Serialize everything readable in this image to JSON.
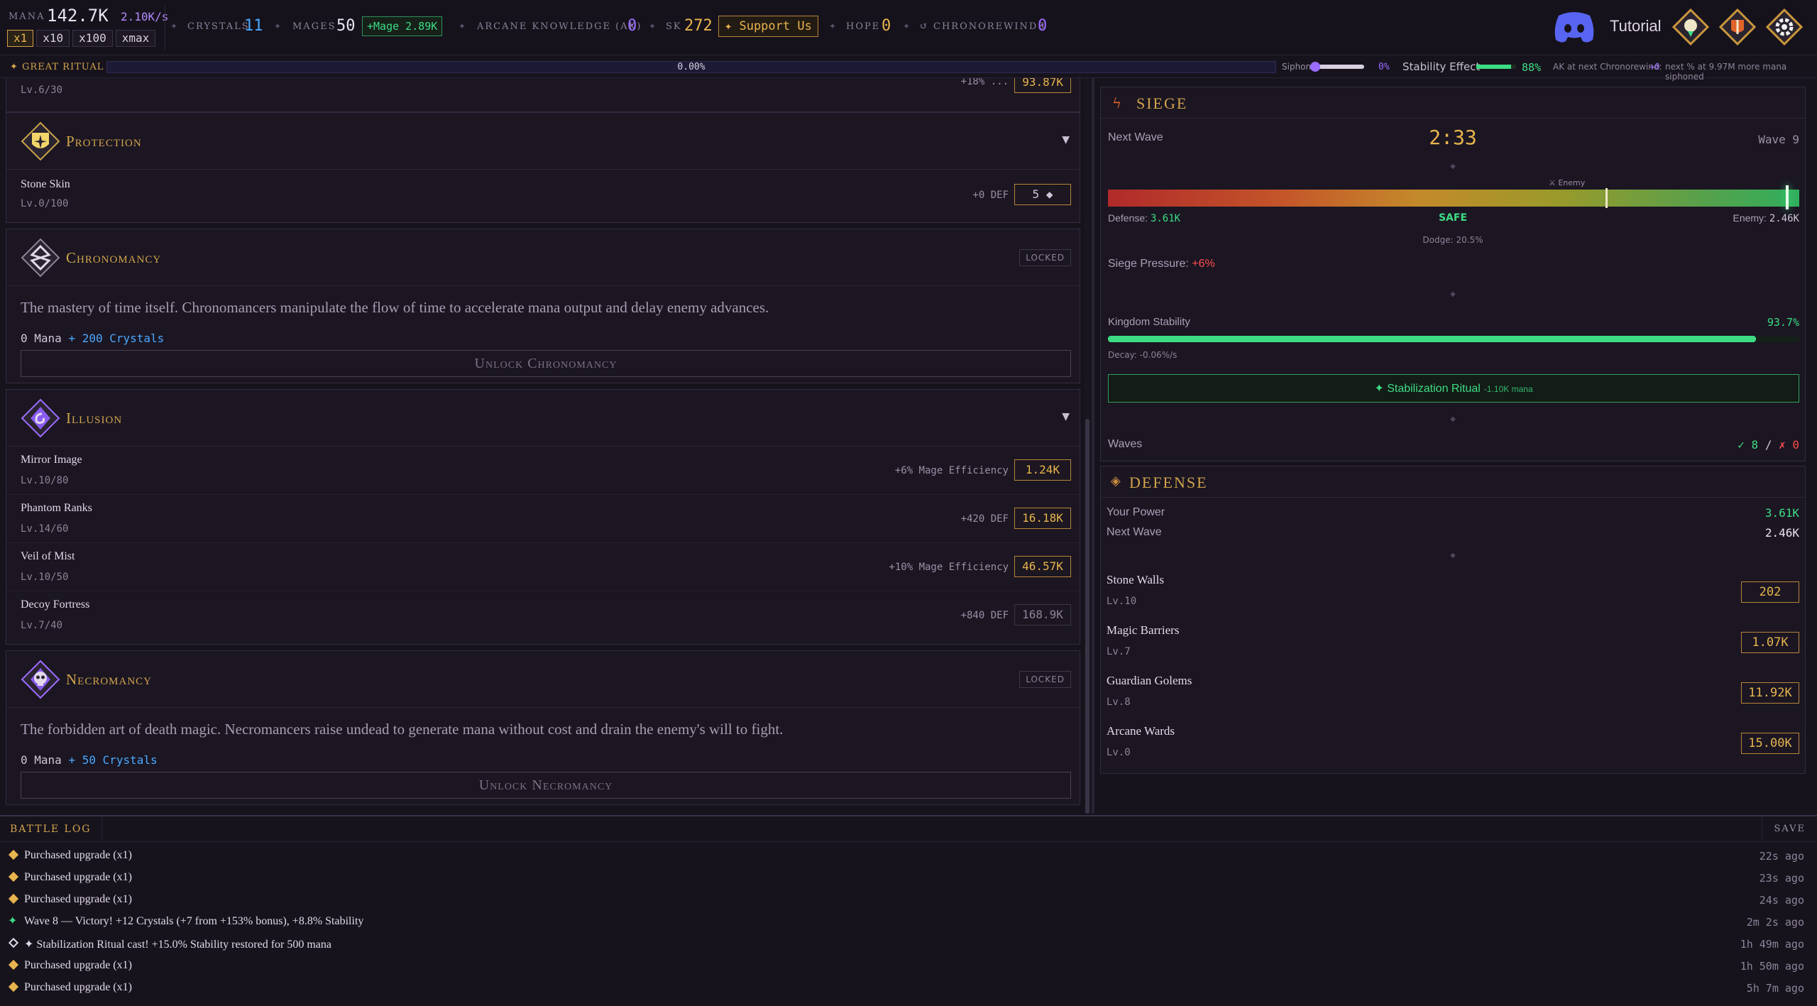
{
  "topbar": {
    "mana_label": "MANA",
    "mana_value": "142.7K",
    "mana_rate": "2.10K/s",
    "multipliers": [
      "x1",
      "x10",
      "x100",
      "xmax"
    ],
    "crystals_label": "CRYSTALS",
    "crystals_value": "11",
    "mages_label": "MAGES",
    "mages_value": "50",
    "mage_button": "+Mage 2.89K",
    "ak_label": "ARCANE KNOWLEDGE (AK)",
    "ak_value": "0",
    "sk_label": "SK",
    "sk_value": "272",
    "support_button": "✦ Support Us",
    "hope_label": "HOPE",
    "hope_value": "0",
    "chronorewinds_label": "↺ CHRONOREWINDS",
    "chronorewinds_value": "0",
    "tutorial_label": "Tutorial"
  },
  "ritual": {
    "label": "✦ GREAT RITUAL",
    "percent": "0.00%",
    "progress": 0.0,
    "siphon_label": "Siphon",
    "siphon_value": "0%",
    "stability_label": "Stability Effect",
    "stability_value": "88%",
    "stability_fill": 0.88,
    "ak_next_label": "AK at next Chronorewind:",
    "ak_next_value": "+0",
    "next_info": "next % at 9.97M more mana siphoned"
  },
  "skills": {
    "top_partial": {
      "level": "Lv.6/30",
      "effect": "+18% ...",
      "cost": "93.87K"
    },
    "protection": {
      "title": "Protection",
      "items": [
        {
          "name": "Stone Skin",
          "level": "Lv.0/100",
          "effect": "+0 DEF",
          "cost": "5 ◆"
        }
      ]
    },
    "chronomancy": {
      "title": "Chronomancy",
      "locked": "LOCKED",
      "description": "The mastery of time itself. Chronomancers manipulate the flow of time to accelerate mana output and delay enemy advances.",
      "cost_mana": "0 Mana",
      "cost_crystals": "+ 200 Crystals",
      "unlock_button": "Unlock Chronomancy"
    },
    "illusion": {
      "title": "Illusion",
      "items": [
        {
          "name": "Mirror Image",
          "level": "Lv.10/80",
          "effect": "+6% Mage Efficiency",
          "cost": "1.24K"
        },
        {
          "name": "Phantom Ranks",
          "level": "Lv.14/60",
          "effect": "+420 DEF",
          "cost": "16.18K"
        },
        {
          "name": "Veil of Mist",
          "level": "Lv.10/50",
          "effect": "+10% Mage Efficiency",
          "cost": "46.57K"
        },
        {
          "name": "Decoy Fortress",
          "level": "Lv.7/40",
          "effect": "+840 DEF",
          "cost": "168.9K"
        }
      ]
    },
    "necromancy": {
      "title": "Necromancy",
      "locked": "LOCKED",
      "description": "The forbidden art of death magic. Necromancers raise undead to generate mana without cost and drain the enemy's will to fight.",
      "cost_mana": "0 Mana",
      "cost_crystals": "+ 50 Crystals",
      "unlock_button": "Unlock Necromancy"
    }
  },
  "siege": {
    "title": "SIEGE",
    "next_wave_label": "Next Wave",
    "timer": "2:33",
    "wave_label": "Wave 9",
    "enemy_marker_label": "⚔ Enemy",
    "enemy_marker_pos": 0.72,
    "defense_marker_pos": 0.98,
    "defense_label": "Defense:",
    "defense_value": "3.61K",
    "status": "SAFE",
    "enemy_label": "Enemy:",
    "enemy_value": "2.46K",
    "dodge": "Dodge: 20.5%",
    "pressure_label": "Siege Pressure:",
    "pressure_value": "+6%",
    "stability_label": "Kingdom Stability",
    "stability_value": "93.7%",
    "stability_fill": 0.937,
    "decay": "Decay: -0.06%/s",
    "ritual_button": "✦ Stabilization Ritual",
    "ritual_cost": "-1.10K mana",
    "waves_label": "Waves",
    "waves_won": "✓ 8",
    "waves_sep": "/",
    "waves_lost": "✗ 0"
  },
  "defense": {
    "title": "DEFENSE",
    "power_label": "Your Power",
    "power_value": "3.61K",
    "next_label": "Next Wave",
    "next_value": "2.46K",
    "items": [
      {
        "name": "Stone Walls",
        "level": "Lv.10",
        "cost": "202"
      },
      {
        "name": "Magic Barriers",
        "level": "Lv.7",
        "cost": "1.07K"
      },
      {
        "name": "Guardian Golems",
        "level": "Lv.8",
        "cost": "11.92K"
      },
      {
        "name": "Arcane Wards",
        "level": "Lv.0",
        "cost": "15.00K"
      }
    ]
  },
  "log": {
    "title": "BATTLE LOG",
    "save": "SAVE",
    "entries": [
      {
        "text": "Purchased upgrade (x1)",
        "time": "22s ago",
        "kind": "purchase"
      },
      {
        "text": "Purchased upgrade (x1)",
        "time": "23s ago",
        "kind": "purchase"
      },
      {
        "text": "Purchased upgrade (x1)",
        "time": "24s ago",
        "kind": "purchase"
      },
      {
        "text": "Wave 8 — Victory! +12 Crystals (+7 from +153% bonus), +8.8% Stability",
        "time": "2m 2s ago",
        "kind": "victory"
      },
      {
        "text": "✦ Stabilization Ritual cast! +15.0% Stability restored for 500 mana",
        "time": "1h 49m ago",
        "kind": "ritual"
      },
      {
        "text": "Purchased upgrade (x1)",
        "time": "1h 50m ago",
        "kind": "purchase"
      },
      {
        "text": "Purchased upgrade (x1)",
        "time": "5h 7m ago",
        "kind": "purchase"
      }
    ]
  },
  "colors": {
    "gold": "#e8b44e",
    "purple": "#9b6cff",
    "green": "#3ddc84",
    "blue": "#4aa8ff",
    "red": "#ff4d4d"
  }
}
